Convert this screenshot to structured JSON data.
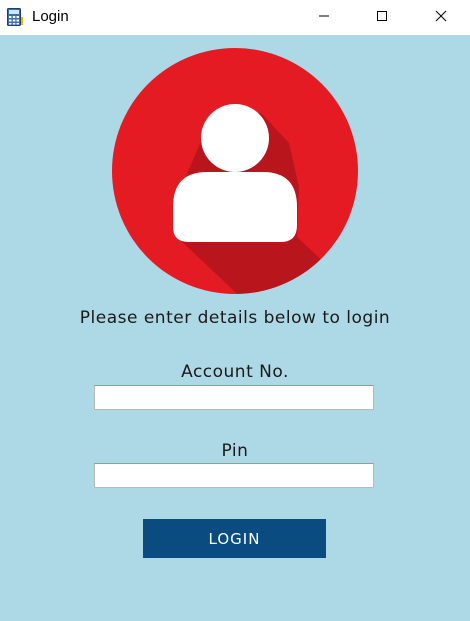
{
  "window": {
    "title": "Login",
    "app_icon": "calculator-icon",
    "controls": {
      "minimize_icon": "minimize-icon",
      "maximize_icon": "maximize-icon",
      "close_icon": "close-icon"
    }
  },
  "avatar": {
    "icon": "user-icon",
    "circle_color": "#E41B23",
    "figure_color": "#FFFFFF"
  },
  "form": {
    "prompt": "Please enter details below to login",
    "account_label": "Account No.",
    "account_value": "",
    "pin_label": "Pin",
    "pin_value": "",
    "login_label": "LOGIN"
  },
  "colors": {
    "background": "#ADD8E6",
    "button": "#0B4C80"
  }
}
